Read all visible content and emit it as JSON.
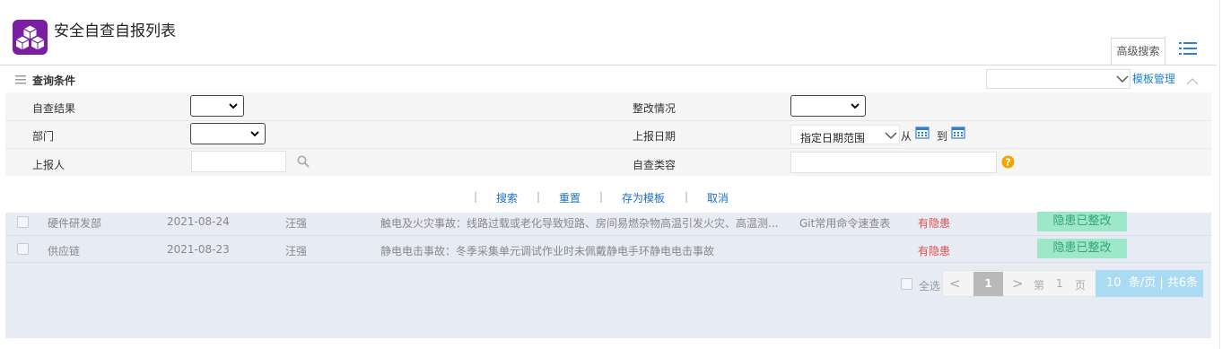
{
  "header": {
    "title": "安全自查自报列表",
    "advanced_search_tab": "高级搜索"
  },
  "query": {
    "title": "查询条件",
    "template_manage": "模板管理",
    "fields": {
      "self_check_result": "自查结果",
      "rectification": "整改情况",
      "department": "部门",
      "report_date": "上报日期",
      "date_range_option": "指定日期范围",
      "from": "从",
      "to": "到",
      "reporter": "上报人",
      "self_check_content": "自查类容"
    }
  },
  "actions": {
    "search": "搜索",
    "reset": "重置",
    "save_template": "存为模板",
    "cancel": "取消",
    "separator": "|"
  },
  "table": {
    "rows": [
      {
        "department": "硬件研发部",
        "date": "2021-08-24",
        "reporter": "汪强",
        "content": "触电及火灾事故：线路过载或老化导致短路、房间易燃杂物高温引发火灾、高温测...",
        "reference": "Git常用命令速查表",
        "hazard": "有隐患",
        "status": "隐患已整改"
      },
      {
        "department": "供应链",
        "date": "2021-08-23",
        "reporter": "汪强",
        "content": "静电电击事故：冬季采集单元调试作业时未佩戴静电手环静电电击事故",
        "reference": "",
        "hazard": "有隐患",
        "status": "隐患已整改"
      }
    ]
  },
  "pager": {
    "select_all": "全选",
    "prev": "<",
    "current_page": "1",
    "next": ">",
    "page_prefix": "第",
    "page_number": "1",
    "page_suffix": "页",
    "per_page": "10",
    "per_page_suffix": "条/页 | 共6条"
  },
  "colors": {
    "app_icon": "#7a1fa2",
    "link": "#1e7fd6",
    "hazard": "#e0504d",
    "status_badge_bg": "#9ee7c8",
    "status_badge_text": "#2fa86f",
    "per_page_bg": "#a9dcf3"
  },
  "icons": {
    "app": "cubes-icon",
    "menu": "list-menu-icon",
    "query": "hamburger-icon",
    "collapse": "chevron-up-icon",
    "search": "magnifier-icon",
    "calendar": "calendar-icon",
    "help": "question-circle-icon"
  }
}
